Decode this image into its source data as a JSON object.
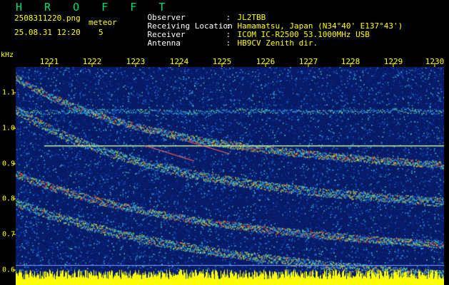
{
  "header": {
    "logo": "H R O F F T",
    "filename": "2508311220.png",
    "timestamp": "25.08.31 12:20",
    "mode_label": "meteor",
    "count": "5"
  },
  "station": [
    {
      "key": "Observer",
      "value": "JL2TBB"
    },
    {
      "key": "Receiving Location",
      "value": "Hamamatsu, Japan (N34°40' E137°43')"
    },
    {
      "key": "Receiver",
      "value": "ICOM IC-R2500 53.1000MHz USB"
    },
    {
      "key": "Antenna",
      "value": "HB9CV Zenith dir."
    }
  ],
  "axis": {
    "y_unit": "kHz",
    "x_ticks": [
      "1221",
      "1222",
      "1223",
      "1224",
      "1225",
      "1226",
      "1227",
      "1228",
      "1229",
      "1230"
    ],
    "y_ticks": [
      "1.1",
      "1.0",
      "0.9",
      "0.8",
      "0.7",
      "0.6"
    ]
  },
  "colors": {
    "background": "#000000",
    "logo": "#00e070",
    "label": "#ffff00",
    "text": "#ffffff",
    "plot_bg": "#061a66"
  }
}
